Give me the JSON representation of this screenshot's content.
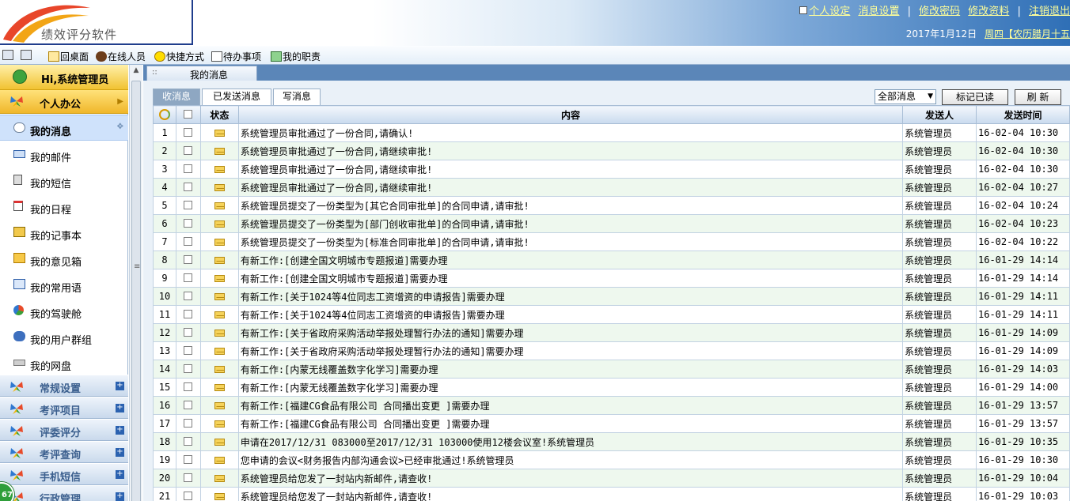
{
  "header": {
    "logo_text": "绩效评分软件",
    "links": [
      "个人设定",
      "消息设置",
      "修改密码",
      "修改资料",
      "注销退出"
    ],
    "date": "2017年1月12日",
    "weekday": "周四【农历腊月十五"
  },
  "toolbar": {
    "items": [
      "回桌面",
      "在线人员",
      "快捷方式",
      "待办事项",
      "我的职责"
    ]
  },
  "sidebar": {
    "user": "Hi,系统管理员",
    "open_section": "个人办公",
    "items": [
      "我的消息",
      "我的邮件",
      "我的短信",
      "我的日程",
      "我的记事本",
      "我的意见箱",
      "我的常用语",
      "我的驾驶舱",
      "我的用户群组",
      "我的网盘"
    ],
    "sections": [
      "常规设置",
      "考评项目",
      "评委评分",
      "考评查询",
      "手机短信",
      "行政管理"
    ],
    "badge": "67"
  },
  "page": {
    "title": "我的消息",
    "tabs": [
      "收消息",
      "已发送消息",
      "写消息"
    ],
    "filter": "全部消息",
    "mark_read": "标记已读",
    "refresh": "刷 新"
  },
  "table": {
    "headers": [
      "状态",
      "内容",
      "发送人",
      "发送时间"
    ],
    "rows": [
      {
        "n": "1",
        "content": "系统管理员审批通过了一份合同,请确认!",
        "sender": "系统管理员",
        "time": "16-02-04 10:30"
      },
      {
        "n": "2",
        "content": "系统管理员审批通过了一份合同,请继续审批!",
        "sender": "系统管理员",
        "time": "16-02-04 10:30"
      },
      {
        "n": "3",
        "content": "系统管理员审批通过了一份合同,请继续审批!",
        "sender": "系统管理员",
        "time": "16-02-04 10:30"
      },
      {
        "n": "4",
        "content": "系统管理员审批通过了一份合同,请继续审批!",
        "sender": "系统管理员",
        "time": "16-02-04 10:27"
      },
      {
        "n": "5",
        "content": "系统管理员提交了一份类型为[其它合同审批单]的合同申请,请审批!",
        "sender": "系统管理员",
        "time": "16-02-04 10:24"
      },
      {
        "n": "6",
        "content": "系统管理员提交了一份类型为[部门创收审批单]的合同申请,请审批!",
        "sender": "系统管理员",
        "time": "16-02-04 10:23"
      },
      {
        "n": "7",
        "content": "系统管理员提交了一份类型为[标准合同审批单]的合同申请,请审批!",
        "sender": "系统管理员",
        "time": "16-02-04 10:22"
      },
      {
        "n": "8",
        "content": "有新工作:[创建全国文明城市专题报道]需要办理",
        "sender": "系统管理员",
        "time": "16-01-29 14:14"
      },
      {
        "n": "9",
        "content": "有新工作:[创建全国文明城市专题报道]需要办理",
        "sender": "系统管理员",
        "time": "16-01-29 14:14"
      },
      {
        "n": "10",
        "content": "有新工作:[关于1024等4位同志工资增资的申请报告]需要办理",
        "sender": "系统管理员",
        "time": "16-01-29 14:11"
      },
      {
        "n": "11",
        "content": "有新工作:[关于1024等4位同志工资增资的申请报告]需要办理",
        "sender": "系统管理员",
        "time": "16-01-29 14:11"
      },
      {
        "n": "12",
        "content": "有新工作:[关于省政府采购活动举报处理暂行办法的通知]需要办理",
        "sender": "系统管理员",
        "time": "16-01-29 14:09"
      },
      {
        "n": "13",
        "content": "有新工作:[关于省政府采购活动举报处理暂行办法的通知]需要办理",
        "sender": "系统管理员",
        "time": "16-01-29 14:09"
      },
      {
        "n": "14",
        "content": "有新工作:[内蒙无线覆盖数字化学习]需要办理",
        "sender": "系统管理员",
        "time": "16-01-29 14:03"
      },
      {
        "n": "15",
        "content": "有新工作:[内蒙无线覆盖数字化学习]需要办理",
        "sender": "系统管理员",
        "time": "16-01-29 14:00"
      },
      {
        "n": "16",
        "content": "有新工作:[福建CG食品有限公司 合同播出变更 ]需要办理",
        "sender": "系统管理员",
        "time": "16-01-29 13:57"
      },
      {
        "n": "17",
        "content": "有新工作:[福建CG食品有限公司 合同播出变更 ]需要办理",
        "sender": "系统管理员",
        "time": "16-01-29 13:57"
      },
      {
        "n": "18",
        "content": "申请在2017/12/31 083000至2017/12/31 103000使用12楼会议室!系统管理员",
        "sender": "系统管理员",
        "time": "16-01-29 10:35"
      },
      {
        "n": "19",
        "content": "您申请的会议<财务报告内部沟通会议>已经审批通过!系统管理员",
        "sender": "系统管理员",
        "time": "16-01-29 10:30"
      },
      {
        "n": "20",
        "content": "系统管理员给您发了一封站内新邮件,请查收!",
        "sender": "系统管理员",
        "time": "16-01-29 10:04"
      },
      {
        "n": "21",
        "content": "系统管理员给您发了一封站内新邮件,请查收!",
        "sender": "系统管理员",
        "time": "16-01-29 10:03"
      }
    ]
  },
  "colors": {
    "header_blue": "#2f6fb6",
    "link_yellow": "#ffff99",
    "section_gold": "#f0b72b",
    "row_even": "#eef8ee",
    "active_tab": "#8ea7c2"
  }
}
